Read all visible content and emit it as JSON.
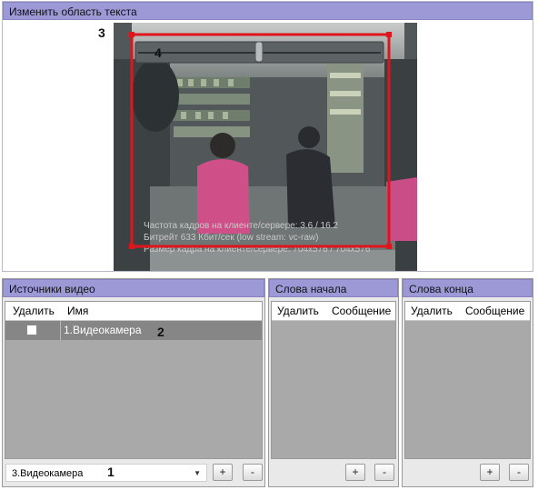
{
  "top_panel": {
    "title": "Изменить область текста"
  },
  "video_overlay": {
    "line1": "Частота кадров на клиенте/сервере: 3.6 / 16.2",
    "line2": "Битрейт 633 Кбит/сек (low stream: vc-raw)",
    "line3": "Размер кадра на клиенте/сервере: 704x576 / 704x576"
  },
  "callouts": {
    "c1": "1",
    "c2": "2",
    "c3": "3",
    "c4": "4"
  },
  "sources_panel": {
    "title": "Источники видео",
    "col_delete": "Удалить",
    "col_name": "Имя",
    "rows": [
      {
        "name": "1.Видеокамера",
        "checked": false
      }
    ],
    "combo_value": "3.Видеокамера",
    "add_label": "+",
    "remove_label": "-"
  },
  "start_words_panel": {
    "title": "Слова начала",
    "col_delete": "Удалить",
    "col_message": "Сообщение",
    "add_label": "+",
    "remove_label": "-"
  },
  "end_words_panel": {
    "title": "Слова конца",
    "col_delete": "Удалить",
    "col_message": "Сообщение",
    "add_label": "+",
    "remove_label": "-"
  },
  "colors": {
    "header": "#9d99d6",
    "selection": "#e0151b",
    "list_bg": "#a9a9a9"
  }
}
